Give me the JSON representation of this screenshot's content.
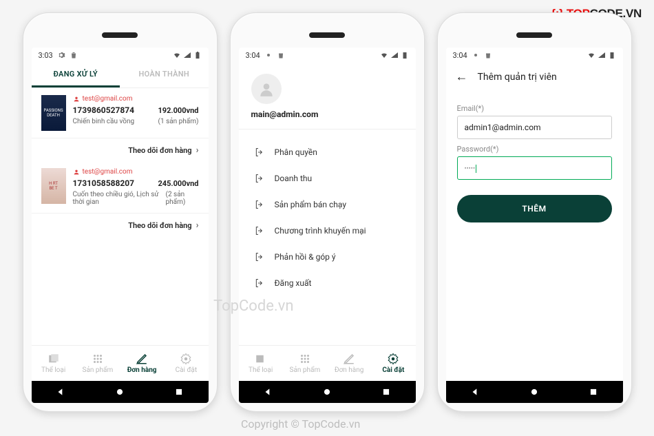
{
  "brand": {
    "bracket": "{;}",
    "t1": "TOP",
    "t2": "CODE.VN"
  },
  "watermark1": "TopCode.vn",
  "watermark2": "Copyright © TopCode.vn",
  "screen1": {
    "time": "3:03",
    "tabs": {
      "active": "ĐANG XỬ LÝ",
      "inactive": "HOÀN THÀNH"
    },
    "orders": [
      {
        "email": "test@gmail.com",
        "id": "1739860527874",
        "price": "192.000vnd",
        "desc": "Chiến binh cầu vồng",
        "count": "(1 sản phẩm)"
      },
      {
        "email": "test@gmail.com",
        "id": "1731058588207",
        "price": "245.000vnd",
        "desc": "Cuốn theo chiều gió, Lịch sử thời gian",
        "count": "(2 sản phẩm)"
      }
    ],
    "track": "Theo dõi đơn hàng",
    "nav": [
      {
        "label": "Thể loại"
      },
      {
        "label": "Sản phẩm"
      },
      {
        "label": "Đơn hàng"
      },
      {
        "label": "Cài đặt"
      }
    ]
  },
  "screen2": {
    "time": "3:04",
    "email": "main@admin.com",
    "menu": [
      "Phân quyền",
      "Doanh thu",
      "Sản phẩm bán chạy",
      "Chương trình khuyến mại",
      "Phản hồi & góp ý",
      "Đăng xuất"
    ],
    "nav": [
      {
        "label": "Thể loại"
      },
      {
        "label": "Sản phẩm"
      },
      {
        "label": "Đơn hàng"
      },
      {
        "label": "Cài đặt"
      }
    ]
  },
  "screen3": {
    "time": "3:04",
    "title": "Thêm quản trị viên",
    "emailLabel": "Email(*)",
    "emailValue": "admin1@admin.com",
    "passLabel": "Password(*)",
    "passValue": "·····",
    "btn": "THÊM"
  }
}
